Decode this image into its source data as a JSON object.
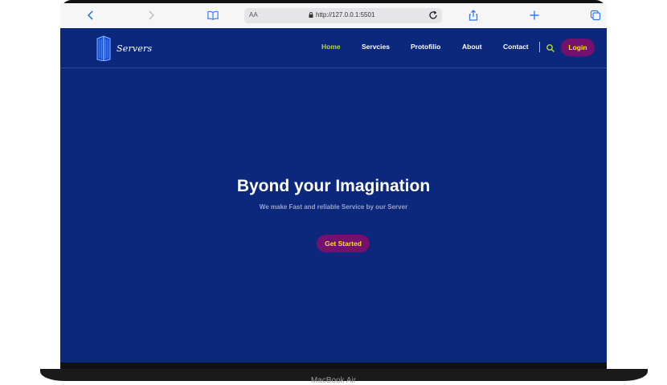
{
  "device": {
    "label": "MacBook Air"
  },
  "browser": {
    "aa_label": "AA",
    "url": "http://127.0.0.1:5501"
  },
  "brand": {
    "name": "Servers"
  },
  "nav": {
    "items": [
      {
        "label": "Home",
        "active": true
      },
      {
        "label": "Servcies",
        "active": false
      },
      {
        "label": "Protofilio",
        "active": false
      },
      {
        "label": "About",
        "active": false
      },
      {
        "label": "Contact",
        "active": false
      }
    ],
    "login_label": "Login"
  },
  "hero": {
    "title": "Byond your Imagination",
    "subtitle": "We make Fast and reliable Service by our Server",
    "cta_label": "Get Started"
  },
  "colors": {
    "page_bg": "#0b287c",
    "accent_active": "#b5d63a",
    "button_bg": "#74106d",
    "button_text": "#f7e017"
  }
}
